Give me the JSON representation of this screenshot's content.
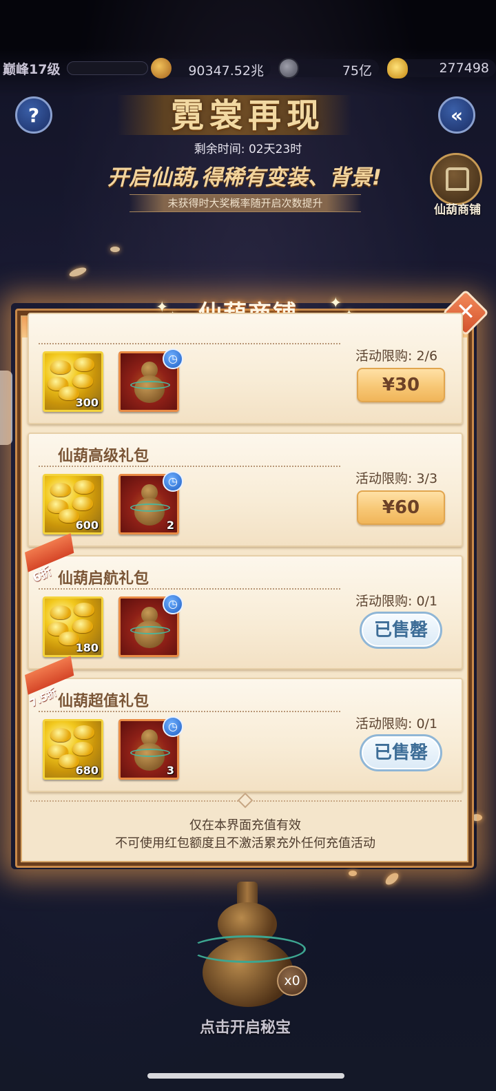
{
  "status_bar": {
    "level": "巅峰17级",
    "resources": [
      {
        "icon": "gold-coin-icon",
        "value": "90347.52兆"
      },
      {
        "icon": "copper-coin-icon",
        "value": "75亿"
      },
      {
        "icon": "gold-ingot-icon",
        "value": "277498"
      }
    ]
  },
  "header": {
    "help_icon": "question-mark-icon",
    "help_label": "?",
    "back_icon": "back-arrow-icon",
    "back_label": "«",
    "title": "霓裳再现",
    "timer_label": "剩余时间:",
    "timer_value": "02天23时",
    "slogan": "开启仙葫,得稀有变装、背景!",
    "hint": "未获得时大奖概率随开启次数提升",
    "shop_entry_label": "仙葫商铺"
  },
  "modal": {
    "title": "仙葫商铺",
    "close_icon": "close-icon",
    "close_label": "✕",
    "packs": [
      {
        "title": "",
        "discount": "",
        "gold_qty": "300",
        "gourd_qty": "",
        "limit_label": "活动限购:",
        "limit_value": "2/6",
        "price": "¥30",
        "sold_out": false
      },
      {
        "title": "仙葫高级礼包",
        "discount": "",
        "gold_qty": "600",
        "gourd_qty": "2",
        "limit_label": "活动限购:",
        "limit_value": "3/3",
        "price": "¥60",
        "sold_out": false
      },
      {
        "title": "仙葫启航礼包",
        "discount": "6折",
        "gold_qty": "180",
        "gourd_qty": "",
        "limit_label": "活动限购:",
        "limit_value": "0/1",
        "price": "已售罄",
        "sold_out": true
      },
      {
        "title": "仙葫超值礼包",
        "discount": "7.5折",
        "gold_qty": "680",
        "gourd_qty": "3",
        "limit_label": "活动限购:",
        "limit_value": "0/1",
        "price": "已售罄",
        "sold_out": true
      }
    ],
    "clock_icon": "clock-icon",
    "footer_line1": "仅在本界面充值有效",
    "footer_line2": "不可使用红包额度且不激活累充外任何充值活动"
  },
  "treasure": {
    "icon": "treasure-gourd-icon",
    "count": "x0",
    "label": "点击开启秘宝"
  }
}
